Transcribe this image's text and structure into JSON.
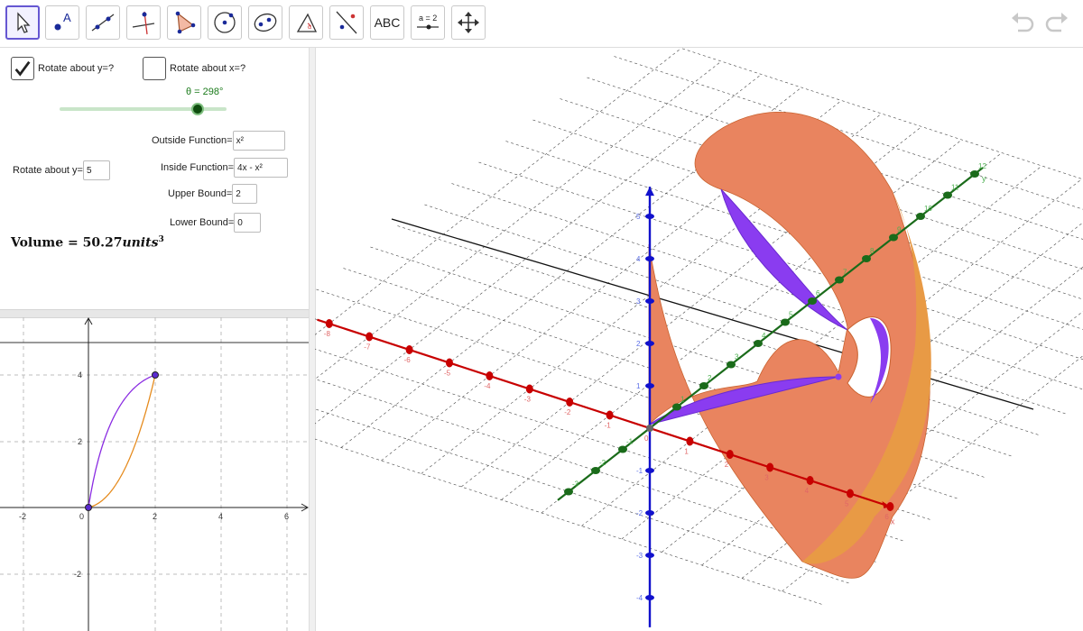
{
  "toolbar": {
    "tools": [
      {
        "name": "move-tool"
      },
      {
        "name": "point-tool",
        "label": "A"
      },
      {
        "name": "line-tool"
      },
      {
        "name": "perpendicular-line-tool"
      },
      {
        "name": "polygon-tool"
      },
      {
        "name": "circle-tool"
      },
      {
        "name": "conic-tool"
      },
      {
        "name": "angle-tool"
      },
      {
        "name": "reflect-tool"
      },
      {
        "name": "text-tool",
        "label": "ABC"
      },
      {
        "name": "slider-tool",
        "label": "a = 2"
      },
      {
        "name": "move-view-tool"
      }
    ],
    "undo": "undo",
    "redo": "redo"
  },
  "algebra": {
    "rotate_y_label": "Rotate about y=?",
    "rotate_y_checked": true,
    "rotate_x_label": "Rotate about x=?",
    "rotate_x_checked": false,
    "theta_label": "θ = 298°",
    "theta_value_deg": 298,
    "theta_max_deg": 360,
    "outside_label": "Outside Function=",
    "outside_value": "x²",
    "inside_label": "Inside Function=",
    "inside_value": "4x - x²",
    "rotate_about_label": "Rotate about y=",
    "rotate_about_value": "5",
    "upper_label": "Upper Bound=",
    "upper_value": "2",
    "lower_label": "Lower Bound=",
    "lower_value": "0",
    "volume_text": "Volume = 50.27",
    "volume_units": "units",
    "volume_exp": "3"
  },
  "graph2d": {
    "x_ticks": [
      "-2",
      "0",
      "2",
      "4",
      "6"
    ],
    "y_ticks": [
      "4",
      "2",
      "-2"
    ],
    "outside_color": "#e58a1c",
    "inside_color": "#8a2be2"
  },
  "graph3d": {
    "x_ticks": [
      "-8",
      "-7",
      "-6",
      "-5",
      "-4",
      "-3",
      "-2",
      "-1",
      "0",
      "1",
      "2",
      "3",
      "4",
      "5",
      "6"
    ],
    "y_ticks": [
      "-3",
      "-2",
      "-1",
      "1",
      "2",
      "3",
      "4",
      "5",
      "6",
      "7",
      "8",
      "9",
      "10",
      "11",
      "12"
    ],
    "z_ticks": [
      "5",
      "4",
      "3",
      "2",
      "1",
      "-1",
      "-2",
      "-3",
      "-4"
    ],
    "x_label": "x",
    "y_label": "y",
    "x_color": "#c80000",
    "y_color": "#1a6b1a",
    "z_color": "#1111cc",
    "solid_color": "#e9845f",
    "cut_color": "#8a3cf0"
  }
}
